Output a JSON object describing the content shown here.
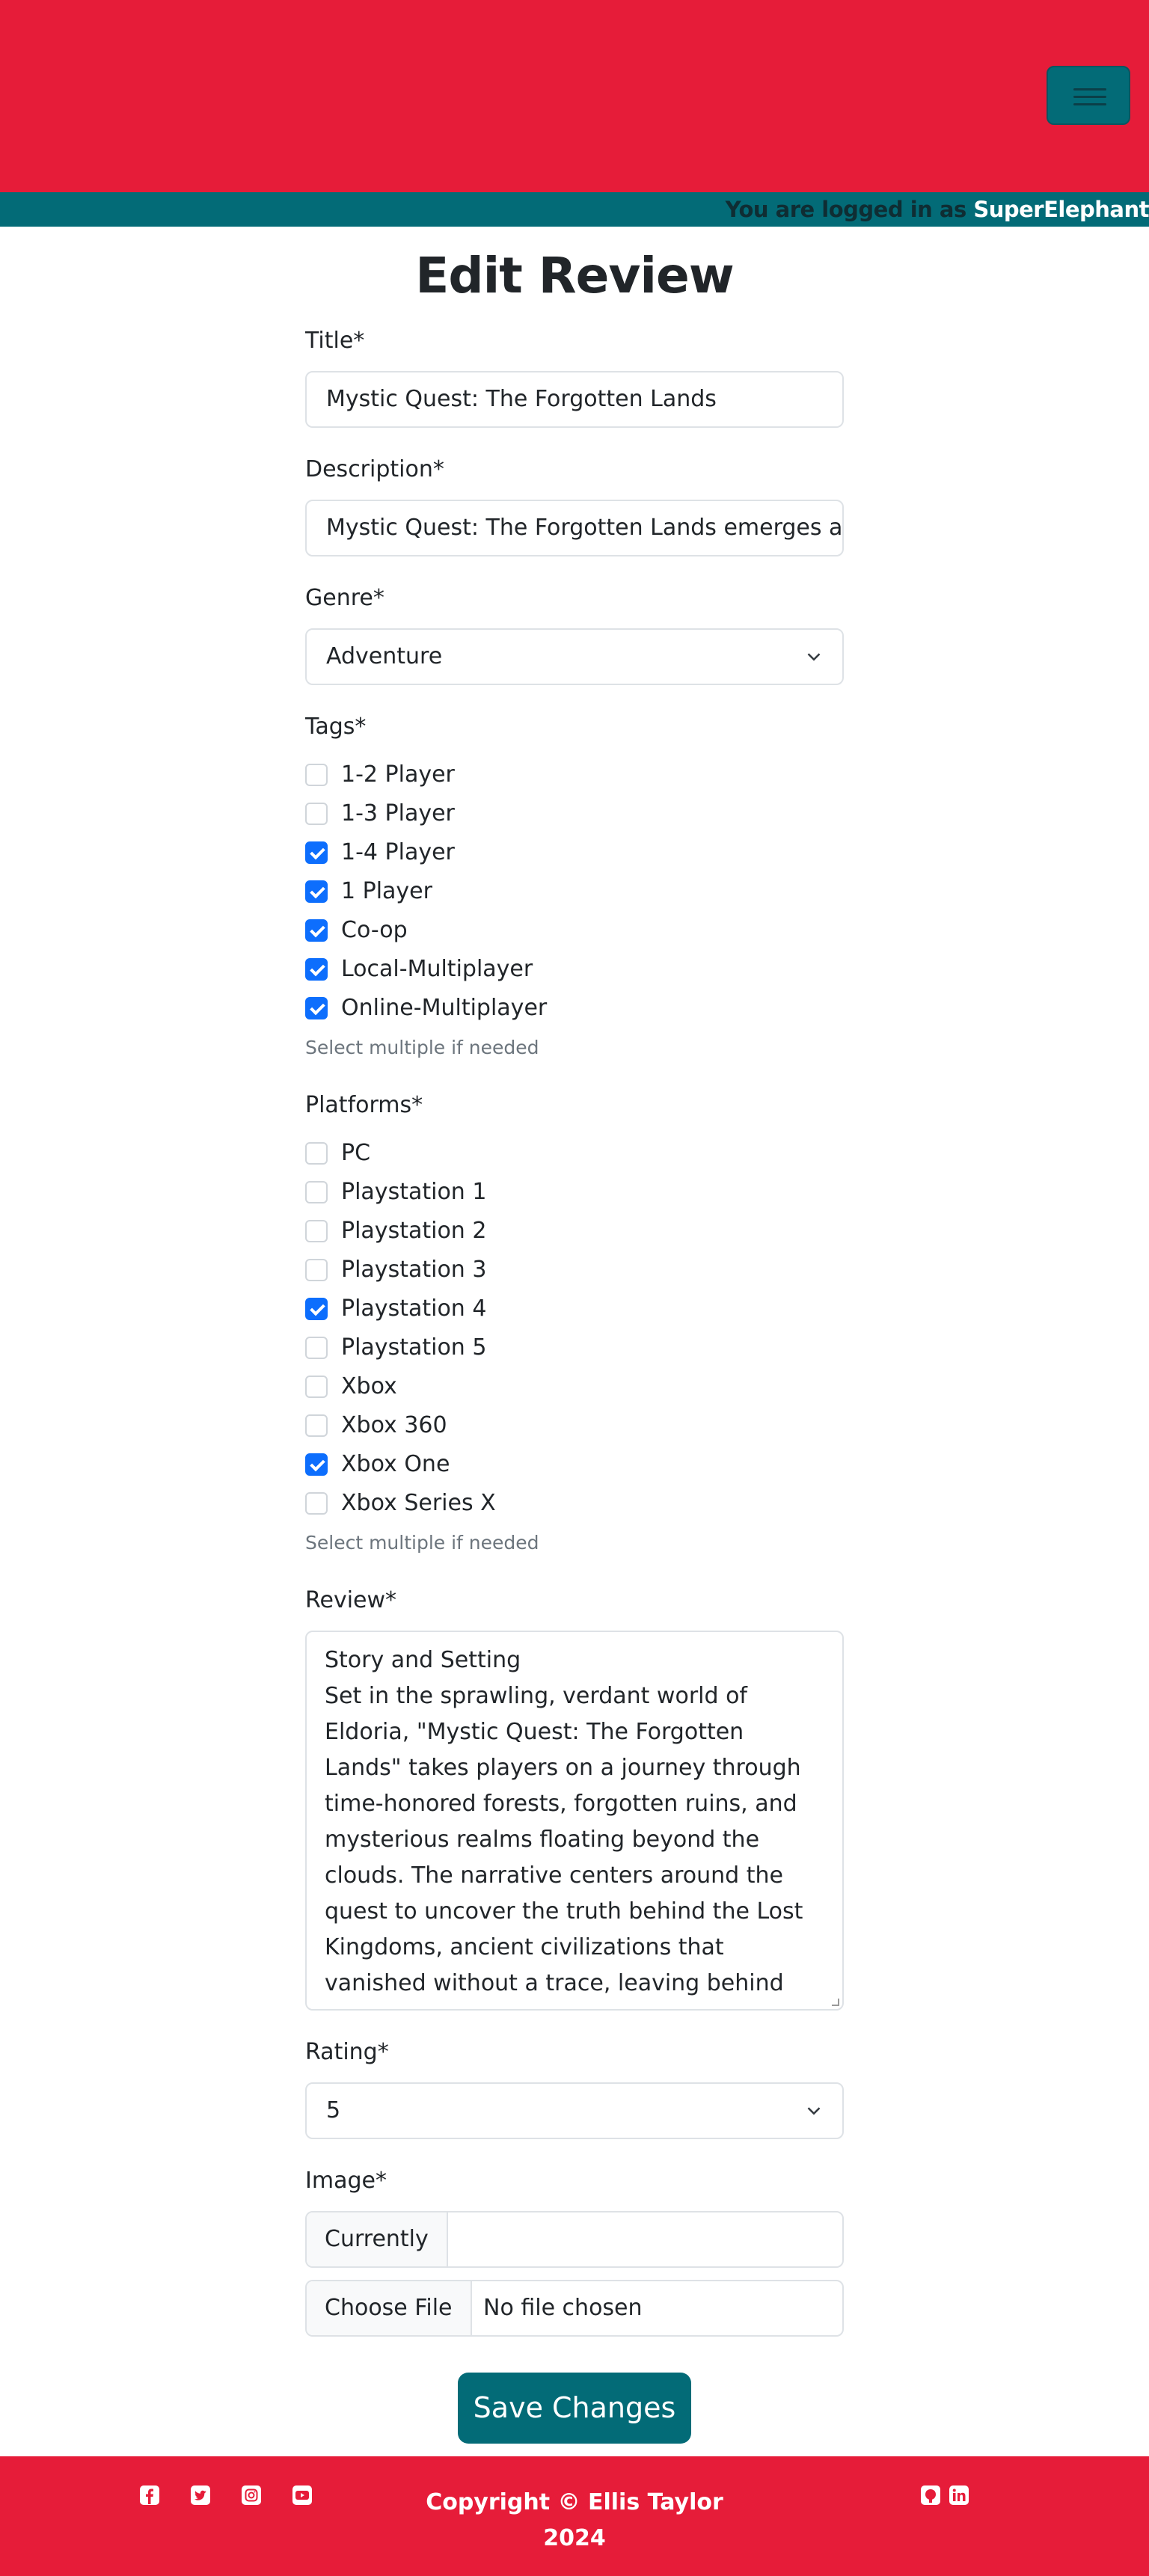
{
  "header": {
    "login_prefix": "You are logged in as",
    "username": "SuperElephant",
    "menu_icon": "hamburger-icon",
    "brand_color": "#e61c39",
    "accent_color": "#036b77"
  },
  "page": {
    "title": "Edit Review"
  },
  "form": {
    "title_label": "Title*",
    "title_value": "Mystic Quest: The Forgotten Lands",
    "description_label": "Description*",
    "description_value": "Mystic Quest: The Forgotten Lands emerges as",
    "genre_label": "Genre*",
    "genre_value": "Adventure",
    "tags_label": "Tags*",
    "tags": [
      {
        "label": "1-2 Player",
        "checked": false
      },
      {
        "label": "1-3 Player",
        "checked": false
      },
      {
        "label": "1-4 Player",
        "checked": true
      },
      {
        "label": "1 Player",
        "checked": true
      },
      {
        "label": "Co-op",
        "checked": true
      },
      {
        "label": "Local-Multiplayer",
        "checked": true
      },
      {
        "label": "Online-Multiplayer",
        "checked": true
      }
    ],
    "tags_hint": "Select multiple if needed",
    "platforms_label": "Platforms*",
    "platforms": [
      {
        "label": "PC",
        "checked": false
      },
      {
        "label": "Playstation 1",
        "checked": false
      },
      {
        "label": "Playstation 2",
        "checked": false
      },
      {
        "label": "Playstation 3",
        "checked": false
      },
      {
        "label": "Playstation 4",
        "checked": true
      },
      {
        "label": "Playstation 5",
        "checked": false
      },
      {
        "label": "Xbox",
        "checked": false
      },
      {
        "label": "Xbox 360",
        "checked": false
      },
      {
        "label": "Xbox One",
        "checked": true
      },
      {
        "label": "Xbox Series X",
        "checked": false
      }
    ],
    "platforms_hint": "Select multiple if needed",
    "review_label": "Review*",
    "review_value": "Story and Setting\nSet in the sprawling, verdant world of Eldoria, \"Mystic Quest: The Forgotten Lands\" takes players on a journey through time-honored forests, forgotten ruins, and mysterious realms floating beyond the clouds. The narrative centers around the quest to uncover the truth behind the Lost Kingdoms, ancient civilizations that vanished without a trace, leaving behind powerful artifacts and puzzles.",
    "rating_label": "Rating*",
    "rating_value": "5",
    "image_label": "Image*",
    "image_current_label": "Currently",
    "image_current_value": "",
    "file_button": "Choose File",
    "file_status": "No file chosen",
    "save_label": "Save Changes"
  },
  "footer": {
    "copyright": "Copyright © Ellis Taylor 2024",
    "social_icons": [
      "facebook-icon",
      "twitter-icon",
      "instagram-icon",
      "youtube-icon"
    ],
    "contact_icons": [
      "github-icon",
      "linkedin-icon"
    ]
  }
}
